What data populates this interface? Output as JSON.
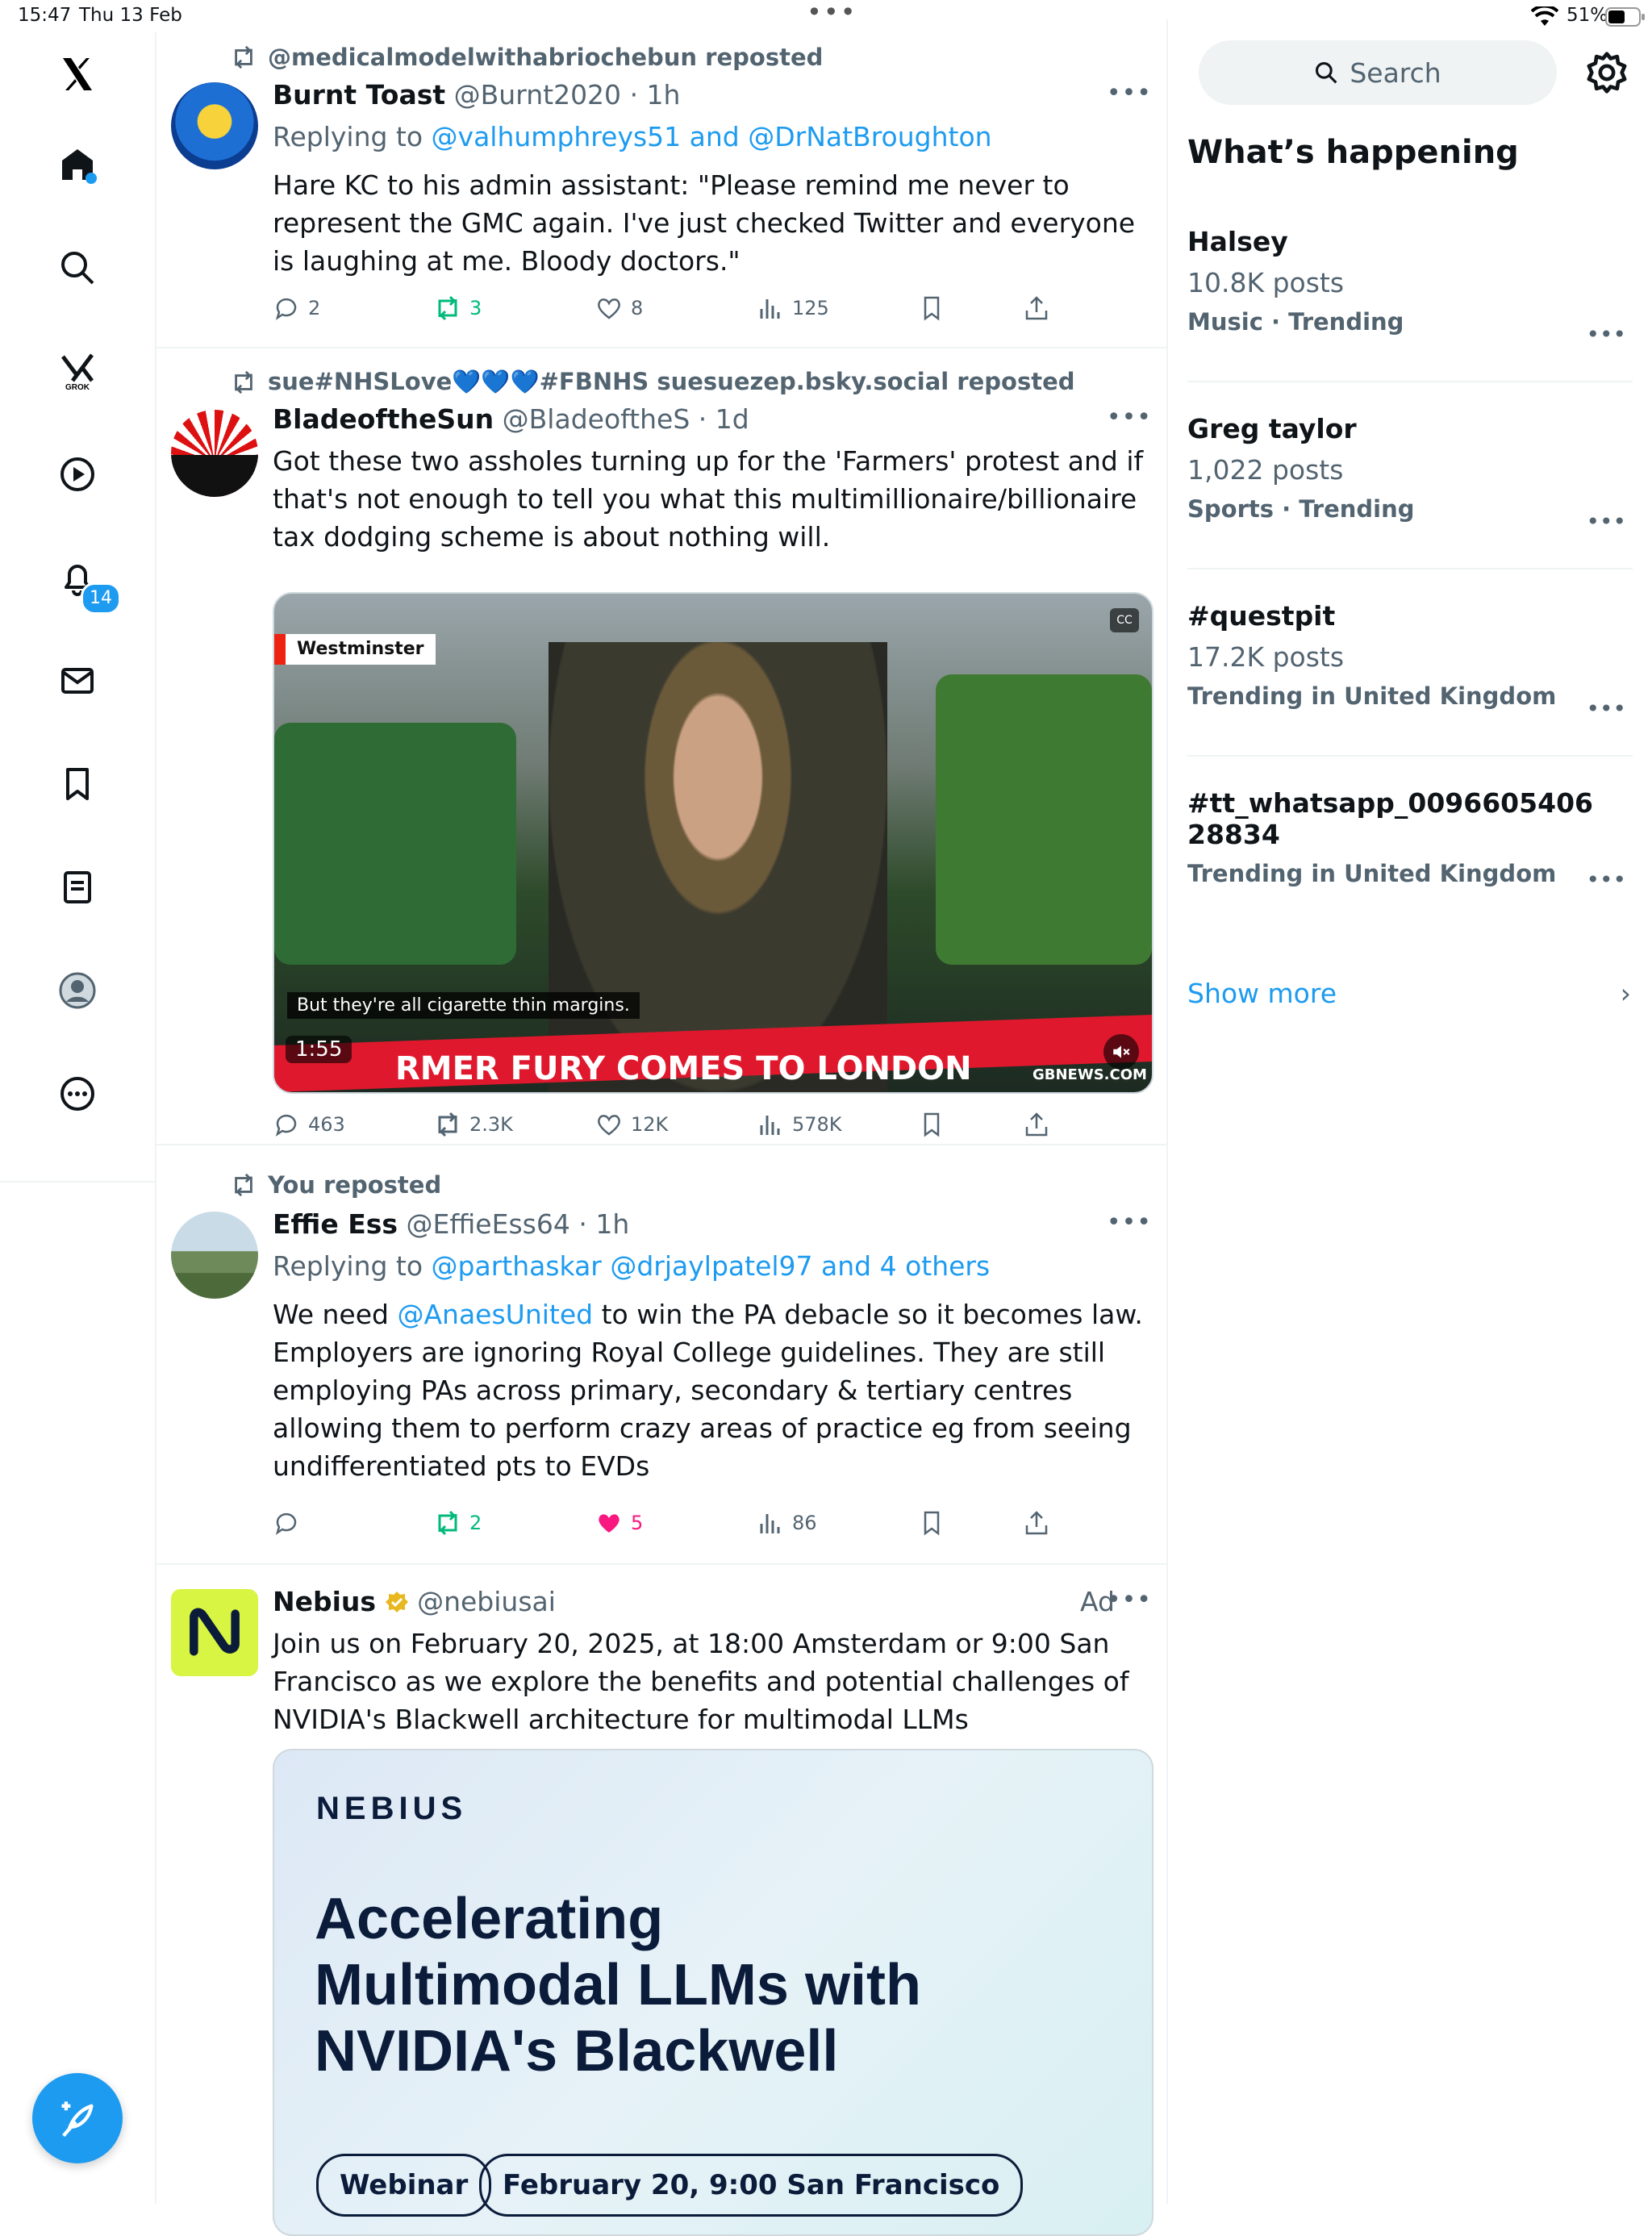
{
  "status_bar": {
    "time": "15:47",
    "date": "Thu 13 Feb",
    "battery": "51%"
  },
  "sidebar": {
    "notifications_badge": "14"
  },
  "tweets": [
    {
      "reposted_by": "@medicalmodelwithabriochebun reposted",
      "name": "Burnt Toast",
      "handle": "@Burnt2020",
      "time": "· 1h",
      "replying_label": "Replying to",
      "replying_to": "@valhumphreys51 and @DrNatBroughton",
      "text": "Hare KC to his admin assistant: \"Please remind me never to represent the GMC again. I've just checked Twitter and everyone is laughing at me. Bloody doctors.\"",
      "replies": "2",
      "reposts": "3",
      "likes": "8",
      "views": "125"
    },
    {
      "reposted_by": "sue#NHSLove💙💙💙#FBNHS suesuezep.bsky.social reposted",
      "name": "BladeoftheSun",
      "handle": "@BladeoftheS",
      "time": "· 1d",
      "text": "Got these two assholes turning up for the 'Farmers' protest and if that's not enough to tell you what this multimillionaire/billionaire tax dodging scheme is about nothing will.",
      "video": {
        "location": "Westminster",
        "caption": "But they're all cigarette thin margins.",
        "duration": "1:55",
        "banner": "RMER FURY COMES TO LONDON",
        "cc": "CC",
        "watermark": "GBNEWS.COM"
      },
      "replies": "463",
      "reposts": "2.3K",
      "likes": "12K",
      "views": "578K"
    },
    {
      "reposted_by": "You reposted",
      "name": "Effie Ess",
      "handle": "@EffieEss64",
      "time": "· 1h",
      "replying_label": "Replying to",
      "replying_to": "@parthaskar @drjaylpatel97 and 4 others",
      "text_pre": "We need ",
      "mention": "@AnaesUnited",
      "text_post": "  to win the PA debacle so it becomes law. Employers are ignoring Royal College guidelines. They are still employing PAs across primary, secondary & tertiary centres allowing them to perform crazy areas of practice eg from seeing undifferentiated pts to EVDs",
      "replies": "",
      "reposts": "2",
      "likes": "5",
      "views": "86"
    },
    {
      "name": "Nebius",
      "handle": "@nebiusai",
      "ad_label": "Ad",
      "text": "Join us on February 20, 2025, at 18:00 Amsterdam or 9:00 San Francisco as we explore the benefits and potential challenges of NVIDIA's Blackwell architecture for multimodal LLMs",
      "card": {
        "logo": "NEBIUS",
        "headline_1": "Accelerating",
        "headline_2": "Multimodal LLMs with",
        "headline_3": "NVIDIA's Blackwell",
        "pill_1": "Webinar",
        "pill_2": "February 20, 9:00 San Francisco"
      }
    }
  ],
  "right": {
    "search_placeholder": "Search",
    "whats_happening": "What’s happening",
    "trends": [
      {
        "name": "Halsey",
        "posts": "10.8K posts",
        "category": "Music · Trending"
      },
      {
        "name": "Greg taylor",
        "posts": "1,022 posts",
        "category": "Sports · Trending"
      },
      {
        "name": "#questpit",
        "posts": "17.2K posts",
        "category": "Trending in United Kingdom"
      },
      {
        "name": "#tt_whatsapp_009660540628834",
        "posts": "",
        "category": "Trending in United Kingdom"
      }
    ],
    "show_more": "Show more"
  },
  "colors": {
    "accent": "#1d9bf0",
    "text": "#0f1419",
    "muted": "#536471",
    "repost_green": "#00ba7c",
    "like_pink": "#f91880"
  }
}
